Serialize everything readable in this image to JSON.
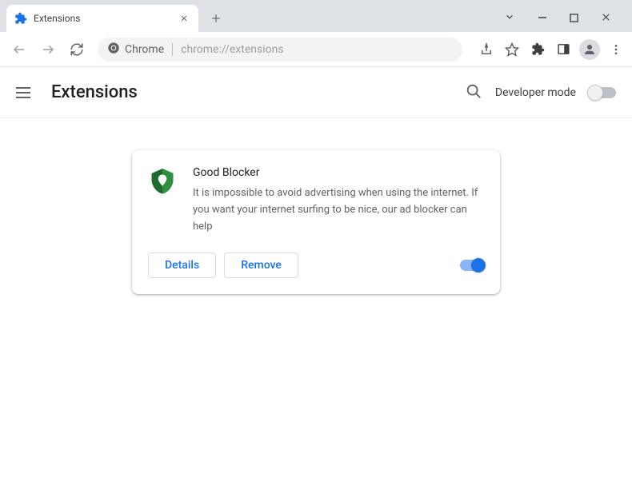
{
  "tab": {
    "title": "Extensions"
  },
  "omnibox": {
    "label": "Chrome",
    "url": "chrome://extensions"
  },
  "header": {
    "title": "Extensions",
    "dev_mode_label": "Developer mode"
  },
  "extension": {
    "name": "Good Blocker",
    "description": "It is impossible to avoid advertising when using the internet. If you want your internet surfing to be nice, our ad blocker can help",
    "details_label": "Details",
    "remove_label": "Remove"
  }
}
